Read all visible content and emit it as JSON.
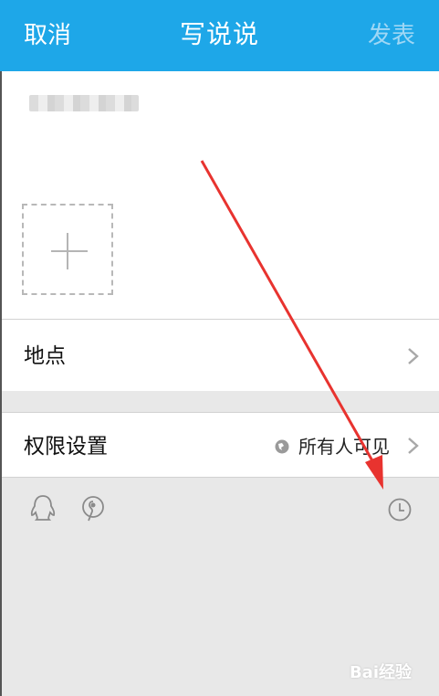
{
  "header": {
    "cancel_label": "取消",
    "title": "写说说",
    "publish_label": "发表"
  },
  "rows": {
    "location_label": "地点",
    "permission_label": "权限设置",
    "permission_value": "所有人可见"
  },
  "toolbar": {
    "icons": [
      "qq-icon",
      "mention-icon",
      "clock-icon"
    ]
  },
  "watermark": "Bai经验",
  "colors": {
    "header_bg": "#1ea7e8",
    "publish_disabled": "#9fd7f5",
    "annotation_arrow": "#e8332f"
  }
}
